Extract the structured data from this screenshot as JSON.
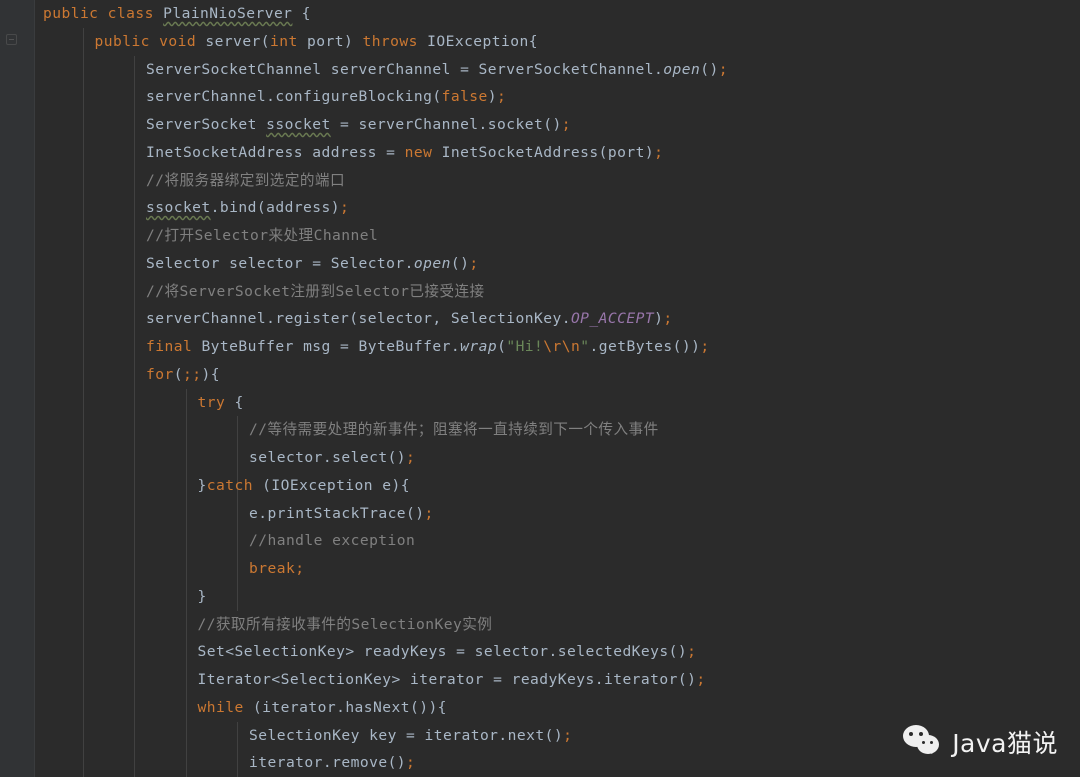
{
  "editor": {
    "theme": "darcula",
    "background": "#2b2b2b",
    "gutter_background": "#313335",
    "colors": {
      "keyword": "#cc7832",
      "comment": "#808080",
      "string": "#6a8759",
      "identifier": "#a9b7c6",
      "constant": "#9876aa",
      "separator": "#cc7832"
    },
    "language": "Java",
    "class_name": "PlainNioServer"
  },
  "gutter": {
    "fold_marker_icon": "fold-collapse-icon"
  },
  "code": {
    "lines": [
      {
        "indent": 0,
        "guides": 0,
        "text": "public class PlainNioServer {"
      },
      {
        "indent": 1,
        "guides": 1,
        "text": "public void server(int port) throws IOException{"
      },
      {
        "indent": 2,
        "guides": 2,
        "text": "ServerSocketChannel serverChannel = ServerSocketChannel.open();"
      },
      {
        "indent": 2,
        "guides": 2,
        "text": "serverChannel.configureBlocking(false);"
      },
      {
        "indent": 2,
        "guides": 2,
        "text": "ServerSocket ssocket = serverChannel.socket();"
      },
      {
        "indent": 2,
        "guides": 2,
        "text": "InetSocketAddress address = new InetSocketAddress(port);"
      },
      {
        "indent": 2,
        "guides": 2,
        "text": "//将服务器绑定到选定的端口"
      },
      {
        "indent": 2,
        "guides": 2,
        "text": "ssocket.bind(address);"
      },
      {
        "indent": 2,
        "guides": 2,
        "text": "//打开Selector来处理Channel"
      },
      {
        "indent": 2,
        "guides": 2,
        "text": "Selector selector = Selector.open();"
      },
      {
        "indent": 2,
        "guides": 2,
        "text": "//将ServerSocket注册到Selector已接受连接"
      },
      {
        "indent": 2,
        "guides": 2,
        "text": "serverChannel.register(selector, SelectionKey.OP_ACCEPT);"
      },
      {
        "indent": 2,
        "guides": 2,
        "text": "final ByteBuffer msg = ByteBuffer.wrap(\"Hi!\\r\\n\".getBytes());"
      },
      {
        "indent": 2,
        "guides": 2,
        "text": "for(;;){"
      },
      {
        "indent": 3,
        "guides": 3,
        "text": "try {"
      },
      {
        "indent": 4,
        "guides": 4,
        "text": "//等待需要处理的新事件；阻塞将一直持续到下一个传入事件"
      },
      {
        "indent": 4,
        "guides": 4,
        "text": "selector.select();"
      },
      {
        "indent": 3,
        "guides": 4,
        "text": "}catch (IOException e){"
      },
      {
        "indent": 4,
        "guides": 4,
        "text": "e.printStackTrace();"
      },
      {
        "indent": 4,
        "guides": 4,
        "text": "//handle exception"
      },
      {
        "indent": 4,
        "guides": 4,
        "text": "break;"
      },
      {
        "indent": 3,
        "guides": 4,
        "text": "}"
      },
      {
        "indent": 3,
        "guides": 3,
        "text": "//获取所有接收事件的SelectionKey实例"
      },
      {
        "indent": 3,
        "guides": 3,
        "text": "Set<SelectionKey> readyKeys = selector.selectedKeys();"
      },
      {
        "indent": 3,
        "guides": 3,
        "text": "Iterator<SelectionKey> iterator = readyKeys.iterator();"
      },
      {
        "indent": 3,
        "guides": 3,
        "text": "while (iterator.hasNext()){"
      },
      {
        "indent": 4,
        "guides": 4,
        "text": "SelectionKey key = iterator.next();"
      },
      {
        "indent": 4,
        "guides": 4,
        "text": "iterator.remove();"
      }
    ]
  },
  "watermark": {
    "icon": "wechat-icon",
    "label": "Java猫说"
  }
}
